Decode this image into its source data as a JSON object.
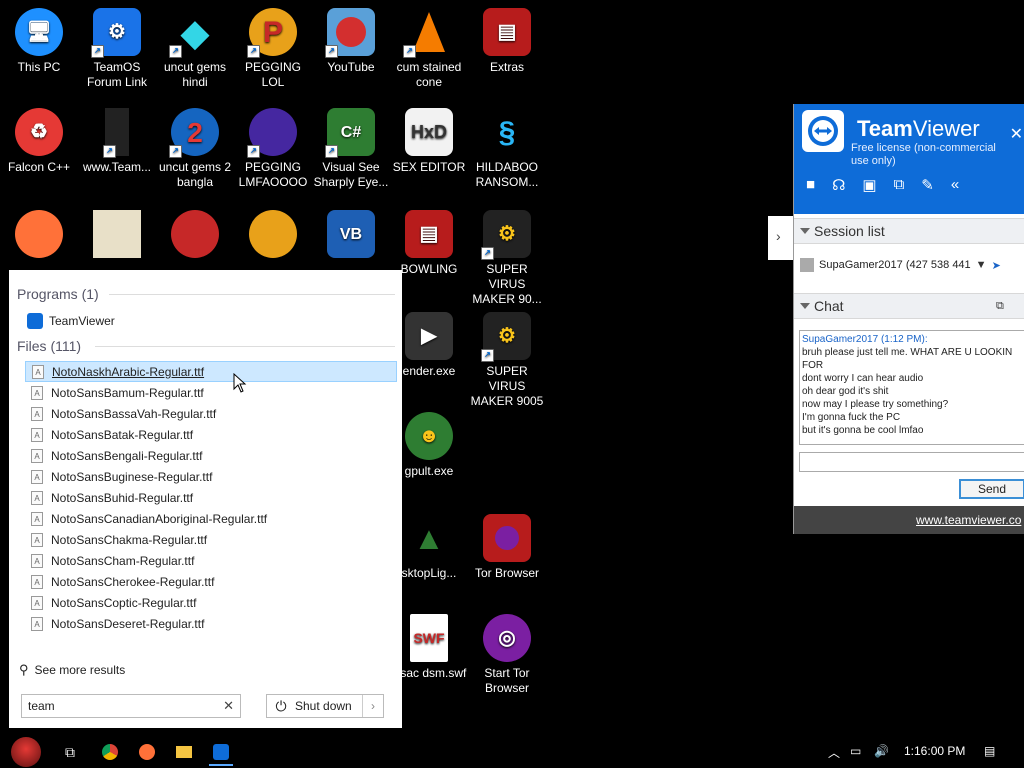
{
  "desktop": {
    "icons": [
      {
        "label": "This PC"
      },
      {
        "label": "TeamOS Forum Link"
      },
      {
        "label": "uncut gems hindi"
      },
      {
        "label": "PEGGING LOL"
      },
      {
        "label": "YouTube"
      },
      {
        "label": "cum stained cone"
      },
      {
        "label": "Extras"
      },
      {
        "label": "Falcon C++"
      },
      {
        "label": "www.Team..."
      },
      {
        "label": "uncut gems 2 bangla"
      },
      {
        "label": "PEGGING LMFAOOOO"
      },
      {
        "label": "Visual See Sharply Eye..."
      },
      {
        "label": "SEX EDITOR"
      },
      {
        "label": "HILDABOO RANSOM..."
      },
      {
        "label": "BOWLING"
      },
      {
        "label": "SUPER VIRUS MAKER 90..."
      },
      {
        "label": "ender.exe"
      },
      {
        "label": "SUPER VIRUS MAKER 9005"
      },
      {
        "label": "gpult.exe"
      },
      {
        "label": "sktopLig..."
      },
      {
        "label": "Tor Browser"
      },
      {
        "label": "issac dsm.swf"
      },
      {
        "label": "Start Tor Browser"
      }
    ]
  },
  "start_menu": {
    "programs_header": "Programs (1)",
    "programs": [
      {
        "label": "TeamViewer"
      }
    ],
    "files_header": "Files (111)",
    "files": [
      "NotoNaskhArabic-Regular.ttf",
      "NotoSansBamum-Regular.ttf",
      "NotoSansBassaVah-Regular.ttf",
      "NotoSansBatak-Regular.ttf",
      "NotoSansBengali-Regular.ttf",
      "NotoSansBuginese-Regular.ttf",
      "NotoSansBuhid-Regular.ttf",
      "NotoSansCanadianAboriginal-Regular.ttf",
      "NotoSansChakma-Regular.ttf",
      "NotoSansCham-Regular.ttf",
      "NotoSansCherokee-Regular.ttf",
      "NotoSansCoptic-Regular.ttf",
      "NotoSansDeseret-Regular.ttf"
    ],
    "selected_file_index": 0,
    "see_more": "See more results",
    "search_value": "team",
    "shutdown_label": "Shut down"
  },
  "teamviewer": {
    "brand_bold": "Team",
    "brand_rest": "Viewer",
    "license": "Free license (non-commercial use only)",
    "session_header": "Session list",
    "session_entry": "SupaGamer2017 (427 538 441",
    "chat_header": "Chat",
    "chat_sender": "SupaGamer2017 (1:12 PM):",
    "chat_lines": [
      "bruh please just tell me. WHAT ARE U LOOKIN",
      "FOR",
      "dont worry I can hear audio",
      "oh dear god it's shit",
      "now may I please try something?",
      "I'm gonna fuck the PC",
      "but it's gonna be cool lmfao"
    ],
    "send_label": "Send",
    "footer_link": "www.teamviewer.co"
  },
  "taskbar": {
    "clock": "1:16:00 PM"
  }
}
